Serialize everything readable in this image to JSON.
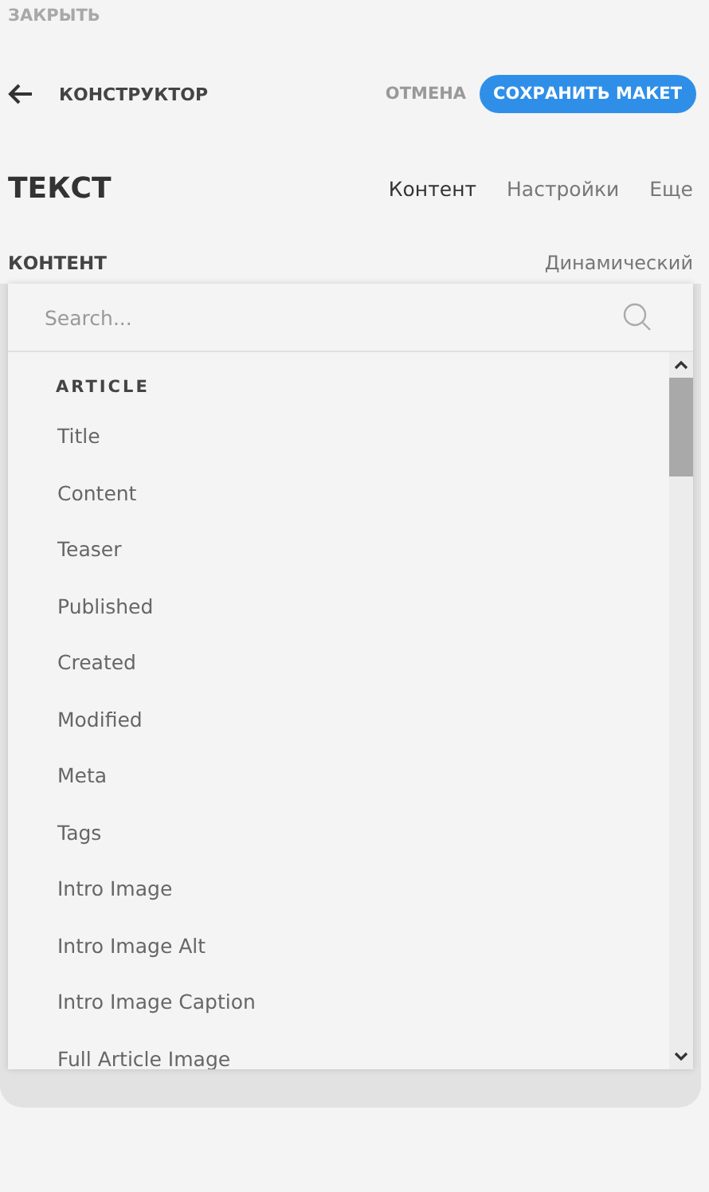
{
  "close_link": "ЗАКРЫТЬ",
  "header": {
    "title": "КОНСТРУКТОР",
    "cancel": "ОТМЕНА",
    "save": "СОХРАНИТЬ МАКЕТ"
  },
  "element": {
    "title": "ТЕКСТ",
    "tabs": [
      {
        "label": "Контент",
        "selected": true
      },
      {
        "label": "Настройки",
        "selected": false
      },
      {
        "label": "Еще",
        "selected": false
      }
    ]
  },
  "field": {
    "label": "КОНТЕНТ",
    "mode": "Динамический"
  },
  "dropdown": {
    "search": {
      "placeholder": "Search..."
    },
    "group": "ARTICLE",
    "items": [
      {
        "label": "Title"
      },
      {
        "label": "Content"
      },
      {
        "label": "Teaser"
      },
      {
        "label": "Published"
      },
      {
        "label": "Created"
      },
      {
        "label": "Modified"
      },
      {
        "label": "Meta"
      },
      {
        "label": "Tags"
      },
      {
        "label": "Intro Image"
      },
      {
        "label": "Intro Image Alt"
      },
      {
        "label": "Intro Image Caption"
      },
      {
        "label": "Full Article Image"
      }
    ]
  }
}
